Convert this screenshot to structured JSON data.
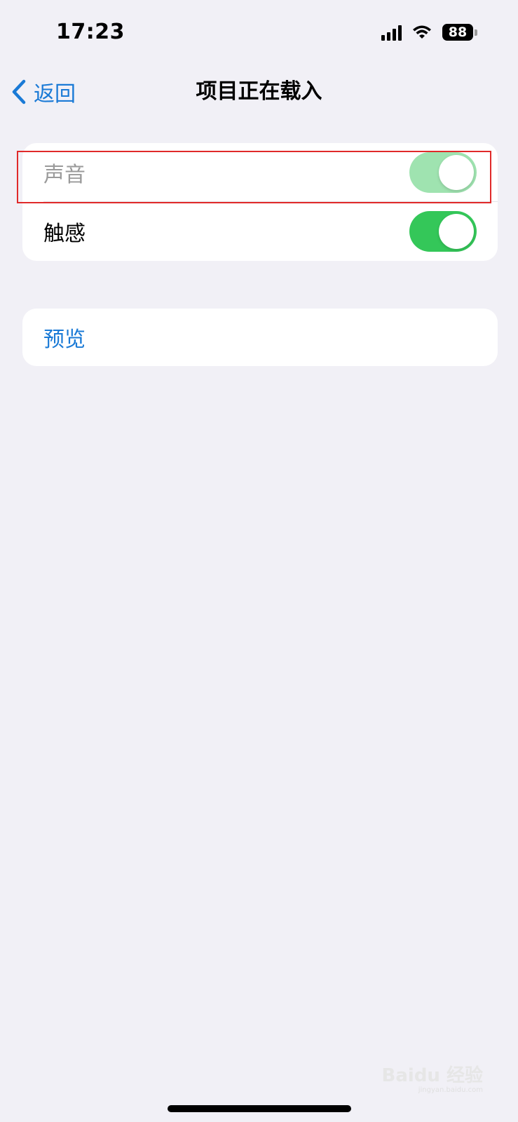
{
  "status_bar": {
    "time": "17:23",
    "battery": "88",
    "icons": [
      "signal-icon",
      "wifi-icon",
      "battery-icon"
    ]
  },
  "nav": {
    "back_label": "返回",
    "title": "项目正在载入"
  },
  "settings": {
    "rows": [
      {
        "label": "声音",
        "toggle_on": true,
        "dimmed": true
      },
      {
        "label": "触感",
        "toggle_on": true,
        "dimmed": false
      }
    ],
    "preview_label": "预览"
  },
  "colors": {
    "accent": "#1a7ad6",
    "toggle_on": "#34c759",
    "highlight": "#e02a2a",
    "background": "#f1f0f6"
  },
  "watermark": {
    "text": "Baidu 经验",
    "sub": "jingyan.baidu.com"
  }
}
